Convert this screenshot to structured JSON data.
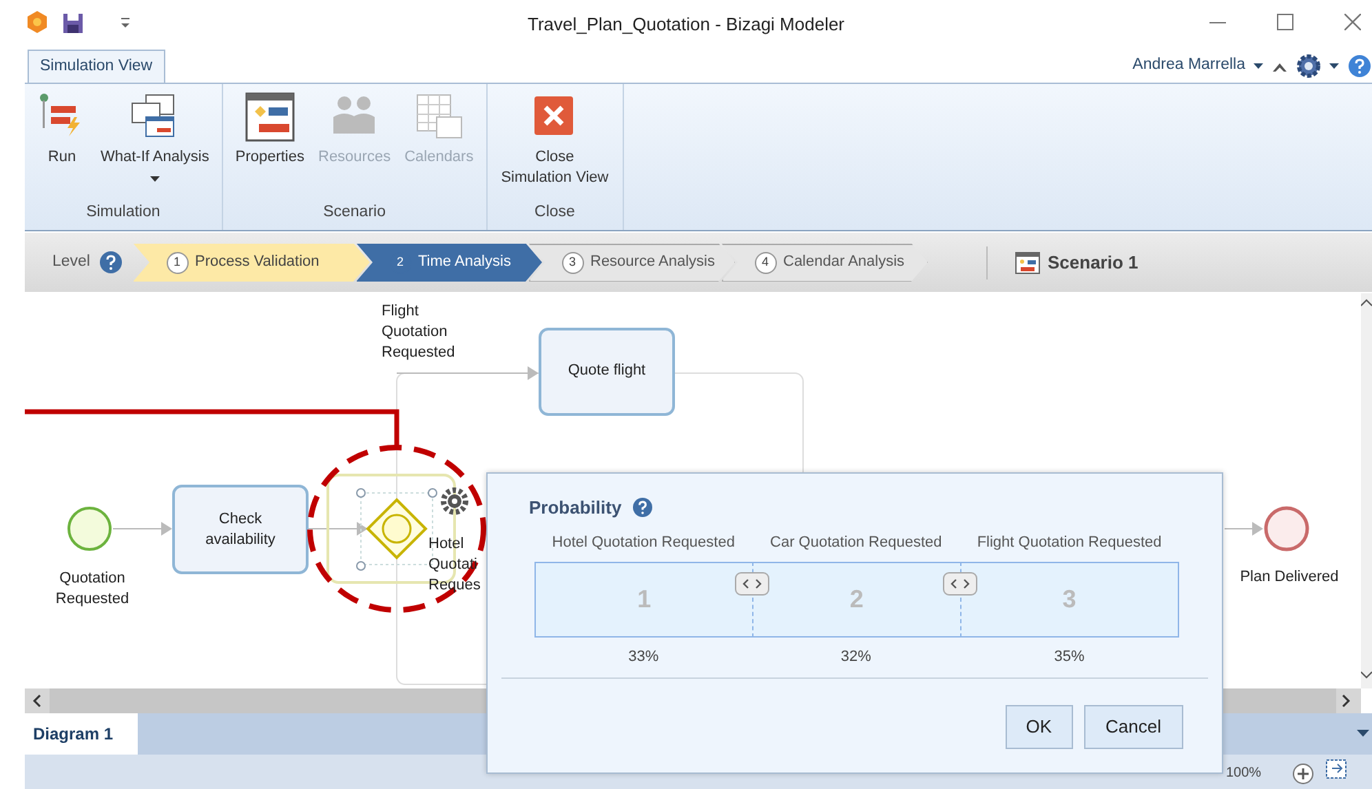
{
  "window": {
    "title": "Travel_Plan_Quotation - Bizagi Modeler"
  },
  "user": {
    "name": "Andrea Marrella"
  },
  "ribbon_tabs": [
    {
      "label": "Simulation View",
      "selected": true
    }
  ],
  "ribbon_groups": [
    {
      "label": "Simulation",
      "buttons": [
        {
          "label": "Run",
          "kind": "run",
          "disabled": false
        },
        {
          "label": "What-If Analysis",
          "kind": "whatif",
          "disabled": false,
          "dropdown": true
        }
      ]
    },
    {
      "label": "Scenario",
      "buttons": [
        {
          "label": "Properties",
          "kind": "properties",
          "disabled": false
        },
        {
          "label": "Resources",
          "kind": "resources",
          "disabled": true
        },
        {
          "label": "Calendars",
          "kind": "calendars",
          "disabled": true
        }
      ]
    },
    {
      "label": "Close",
      "buttons": [
        {
          "label": "Close Simulation View",
          "kind": "close",
          "disabled": false
        }
      ]
    }
  ],
  "level_bar": {
    "label": "Level",
    "steps": [
      {
        "number": "1",
        "label": "Process Validation",
        "completed": true,
        "selected": false
      },
      {
        "number": "2",
        "label": "Time Analysis",
        "completed": false,
        "selected": true
      },
      {
        "number": "3",
        "label": "Resource Analysis",
        "completed": false,
        "selected": false
      },
      {
        "number": "4",
        "label": "Calendar Analysis",
        "completed": false,
        "selected": false
      }
    ],
    "scenario": "Scenario 1"
  },
  "diagram": {
    "nodes": [
      {
        "kind": "flow_label",
        "label": "Flight Quotation Requested"
      },
      {
        "kind": "task",
        "label": "Quote flight"
      },
      {
        "kind": "start",
        "label": "Quotation Requested"
      },
      {
        "kind": "task",
        "label": "Check availability"
      },
      {
        "kind": "gateway",
        "label": "Hotel Quotati Reques",
        "selected": true
      },
      {
        "kind": "end",
        "label": "Plan Delivered"
      }
    ]
  },
  "diagram_tabs": [
    {
      "label": "Diagram 1",
      "selected": true
    }
  ],
  "zoom": {
    "reading": "100%"
  },
  "dialog": {
    "title": "Probability",
    "segments": [
      {
        "label": "Hotel Quotation Requested",
        "number": "1",
        "percent": "33%"
      },
      {
        "label": "Car Quotation Requested",
        "number": "2",
        "percent": "32%"
      },
      {
        "label": "Flight Quotation Requested",
        "number": "3",
        "percent": "35%"
      }
    ],
    "buttons": [
      "OK",
      "Cancel"
    ]
  }
}
